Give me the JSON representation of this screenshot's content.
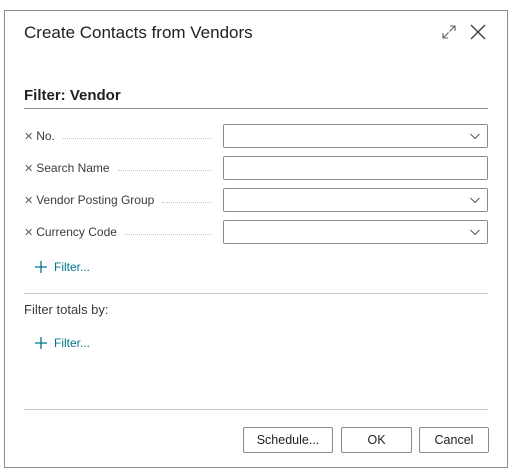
{
  "dialog": {
    "title": "Create Contacts from Vendors"
  },
  "filter_section": {
    "title": "Filter: Vendor",
    "rows": [
      {
        "label": "No.",
        "value": "",
        "has_dropdown": true
      },
      {
        "label": "Search Name",
        "value": "",
        "has_dropdown": false
      },
      {
        "label": "Vendor Posting Group",
        "value": "",
        "has_dropdown": true
      },
      {
        "label": "Currency Code",
        "value": "",
        "has_dropdown": true
      }
    ],
    "add_filter_label": "Filter..."
  },
  "totals_section": {
    "title": "Filter totals by:",
    "add_filter_label": "Filter..."
  },
  "buttons": {
    "schedule": "Schedule...",
    "ok": "OK",
    "cancel": "Cancel"
  },
  "colors": {
    "accent": "#00758c",
    "border": "#8a8a8a"
  }
}
